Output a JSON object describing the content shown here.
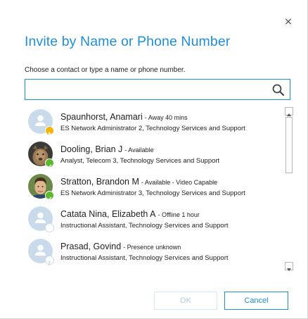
{
  "dialog": {
    "close_glyph": "×",
    "title": "Invite by Name or Phone Number",
    "instruction": "Choose a contact or type a name or phone number.",
    "search": {
      "value": "",
      "placeholder": ""
    },
    "buttons": {
      "ok": "OK",
      "cancel": "Cancel"
    }
  },
  "contacts": [
    {
      "name": "Spaunhorst, Anamari",
      "status": "- Away 40 mins",
      "title": "ES Network Administrator 2, Technology Services and Support",
      "presence": "away",
      "avatar": "default"
    },
    {
      "name": "Dooling, Brian J",
      "status": "- Available",
      "title": "Analyst, Telecom 3, Technology Services and Support",
      "presence": "available",
      "avatar": "photo-cat"
    },
    {
      "name": "Stratton, Brandon M",
      "status": "- Available - Video Capable",
      "title": "ES Network Administrator 3, Technology Services and Support",
      "presence": "available",
      "avatar": "photo-person"
    },
    {
      "name": "Catata Nina, Elizabeth A",
      "status": "- Offline 1 hour",
      "title": "Instructional Assistant, Technology Services and Support",
      "presence": "offline",
      "avatar": "default"
    },
    {
      "name": "Prasad, Govind",
      "status": "- Presence unknown",
      "title": "Instructional Assistant, Technology Services and Support",
      "presence": "unknown",
      "avatar": "default"
    }
  ],
  "colors": {
    "accent": "#1e8fd6",
    "away": "#f5b400",
    "available": "#5cb82c",
    "avatar_bg": "#c9dbea"
  }
}
